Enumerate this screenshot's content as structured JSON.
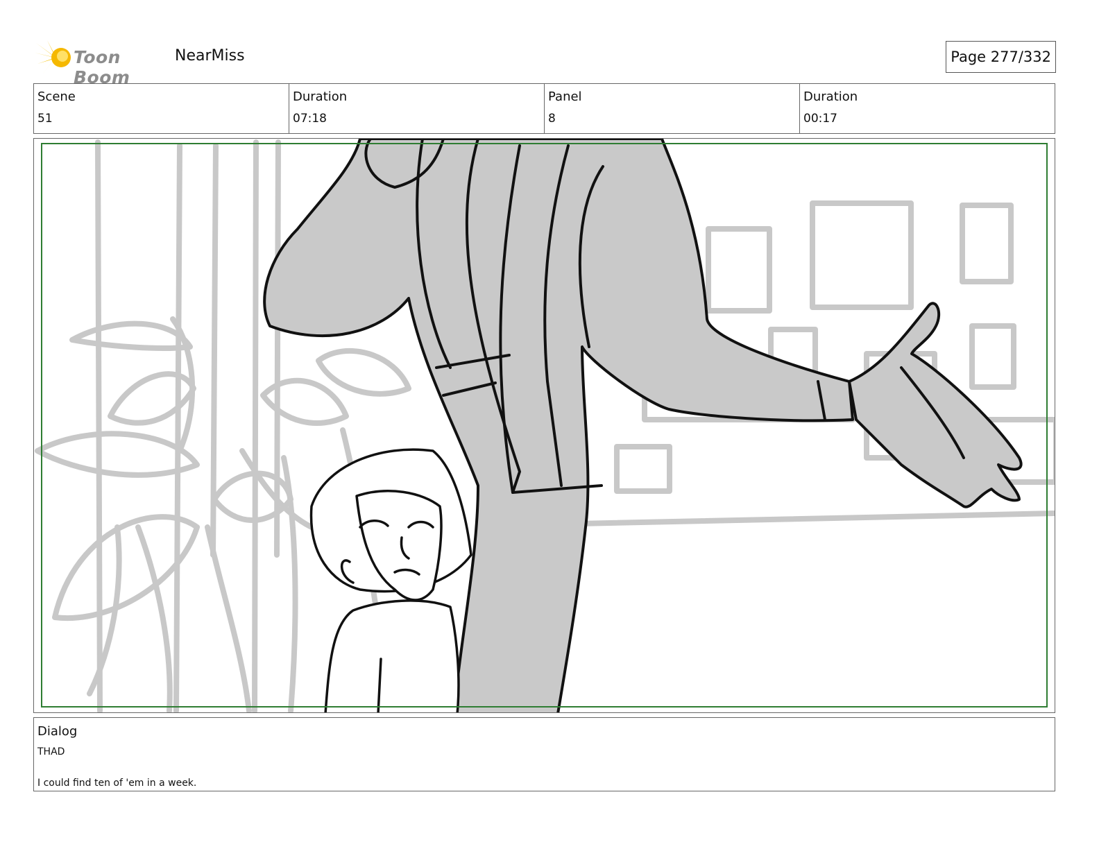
{
  "header": {
    "logo_text": "Toon Boom",
    "project_title": "NearMiss",
    "page_label": "Page 277/332"
  },
  "info": {
    "cells": [
      {
        "label": "Scene",
        "value": "51"
      },
      {
        "label": "Duration",
        "value": "07:18"
      },
      {
        "label": "Panel",
        "value": "8"
      },
      {
        "label": "Duration",
        "value": "00:17"
      }
    ]
  },
  "panel": {
    "image_icon": "storyboard-sketch",
    "safe_frame_color": "#2e7d32"
  },
  "dialog": {
    "label": "Dialog",
    "speaker": "THAD",
    "line": "I could find ten of 'em in a week."
  },
  "colors": {
    "logo_accent": "#f5c518",
    "border": "#666666",
    "sketch_gray": "#c8c8c8"
  }
}
